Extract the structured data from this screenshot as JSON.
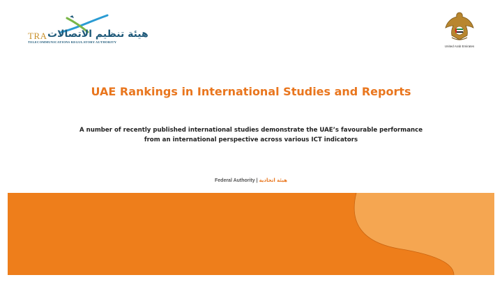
{
  "header": {
    "tra_logo": {
      "mark": "TRA",
      "arabic_name": "هيئة تنظيم الاتصالات",
      "english_name": "TELECOMMUNICATIONS REGULATORY AUTHORITY"
    },
    "uae_emblem": {
      "caption": "United Arab Emirates"
    }
  },
  "slide": {
    "title": "UAE Rankings in International Studies and Reports",
    "subtitle_line1": "A number of recently published international studies demonstrate the UAE’s favourable performance",
    "subtitle_line2": "from an international perspective across various ICT indicators"
  },
  "footer": {
    "federal_authority_en": "Federal Authority |",
    "federal_authority_ar": "هيئة اتحادية"
  },
  "colors": {
    "accent_orange": "#ee7e1b",
    "light_orange": "#f5a651",
    "title_orange": "#e9761e"
  }
}
